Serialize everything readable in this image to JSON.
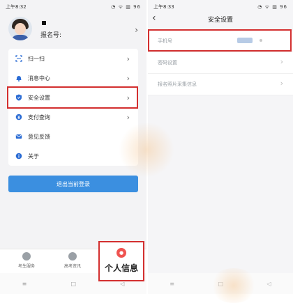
{
  "left": {
    "status": {
      "time": "上午8:32",
      "icons": "◔ ᯤ ▥ 96"
    },
    "profile": {
      "name": "",
      "id_label": "报名号:"
    },
    "menu": [
      {
        "label": "扫一扫",
        "icon": "scan-icon"
      },
      {
        "label": "消息中心",
        "icon": "bell-icon"
      },
      {
        "label": "安全设置",
        "icon": "shield-icon"
      },
      {
        "label": "支付查询",
        "icon": "pay-icon"
      },
      {
        "label": "意见反馈",
        "icon": "mail-icon"
      },
      {
        "label": "关于",
        "icon": "info-icon"
      }
    ],
    "logout": "退出当前登录",
    "tabs": {
      "service": "考生服务",
      "news": "高考资讯",
      "me": "个人信息"
    },
    "nav": {
      "menu": "≡",
      "home": "□",
      "back": "◁"
    }
  },
  "right": {
    "status": {
      "time": "上午8:33",
      "icons": "◔ ᯤ ▥ 96"
    },
    "title": "安全设置",
    "items": [
      {
        "label": "手机号"
      },
      {
        "label": "密码设置"
      },
      {
        "label": "报名照片采集信息"
      }
    ],
    "nav": {
      "menu": "≡",
      "home": "□",
      "back": "◁"
    }
  },
  "colors": {
    "accent": "#3b8fe0",
    "highlight": "#d32f2f",
    "tab_active": "#ef5350"
  }
}
